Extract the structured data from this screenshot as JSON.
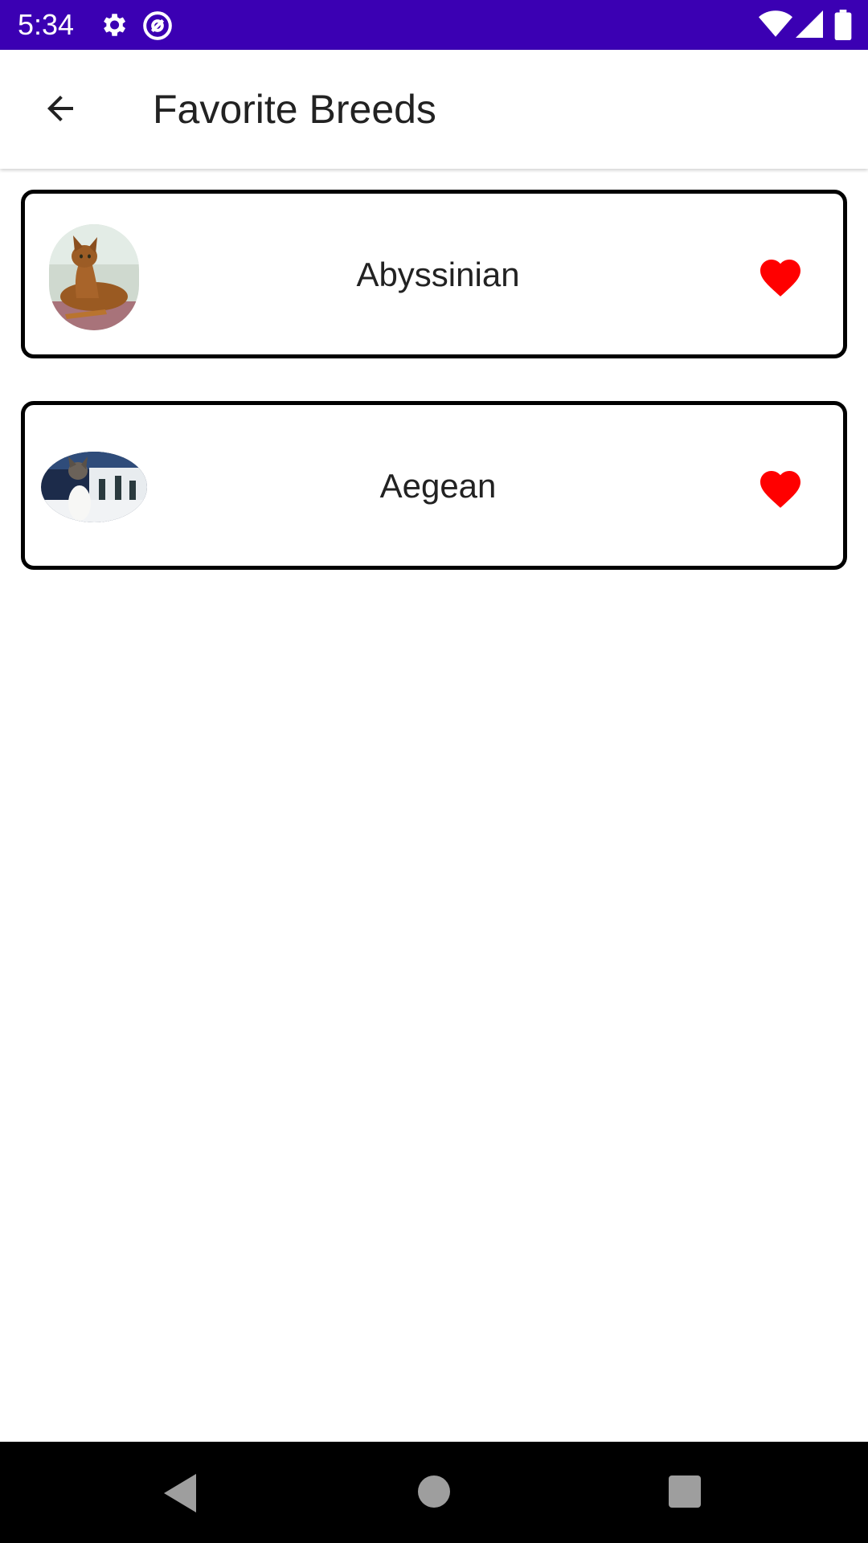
{
  "status_bar": {
    "time": "5:34",
    "icons": [
      "gear-icon",
      "at-sign-icon",
      "wifi-icon",
      "signal-icon",
      "battery-icon"
    ],
    "background": "#3b00b3"
  },
  "app_bar": {
    "title": "Favorite Breeds",
    "back_icon": "arrow-back-icon"
  },
  "favorites": [
    {
      "name": "Abyssinian",
      "favorite_icon": "heart-icon",
      "heart_color": "#ff0000"
    },
    {
      "name": "Aegean",
      "favorite_icon": "heart-icon",
      "heart_color": "#ff0000"
    }
  ],
  "nav_bar": {
    "icons": [
      "back-triangle-icon",
      "home-circle-icon",
      "recents-square-icon"
    ]
  }
}
